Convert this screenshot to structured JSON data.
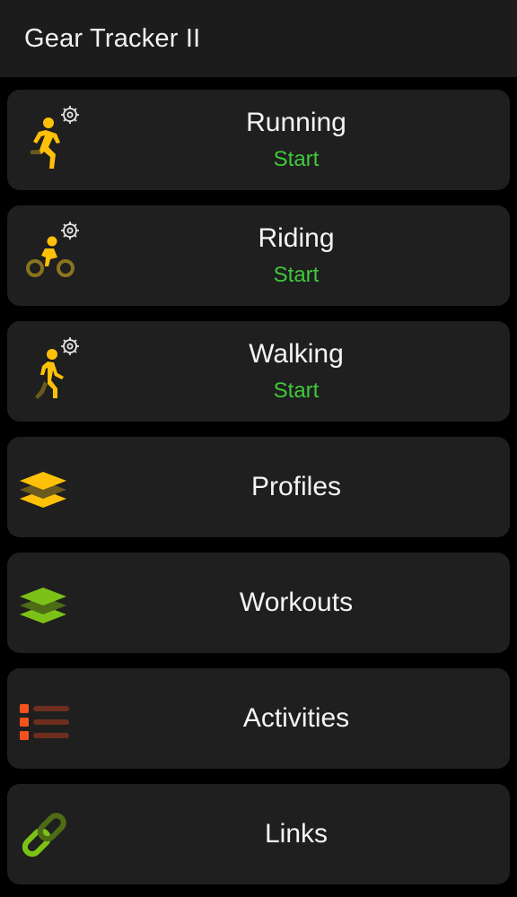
{
  "appbar": {
    "title": "Gear Tracker II"
  },
  "colors": {
    "yellow": "#ffc107",
    "dark_yellow": "#6b5a1d",
    "green": "#7cc117",
    "dark_green": "#4e6b16",
    "orange": "#f4511e",
    "dark_orange": "#6e2e1e",
    "start_green": "#3fc93a"
  },
  "items": [
    {
      "label": "Running",
      "sub": "Start",
      "icon": "running-gear-icon"
    },
    {
      "label": "Riding",
      "sub": "Start",
      "icon": "cycling-gear-icon"
    },
    {
      "label": "Walking",
      "sub": "Start",
      "icon": "walking-gear-icon"
    },
    {
      "label": "Profiles",
      "icon": "layers-icon"
    },
    {
      "label": "Workouts",
      "icon": "layers-icon"
    },
    {
      "label": "Activities",
      "icon": "list-icon"
    },
    {
      "label": "Links",
      "icon": "link-icon"
    }
  ]
}
